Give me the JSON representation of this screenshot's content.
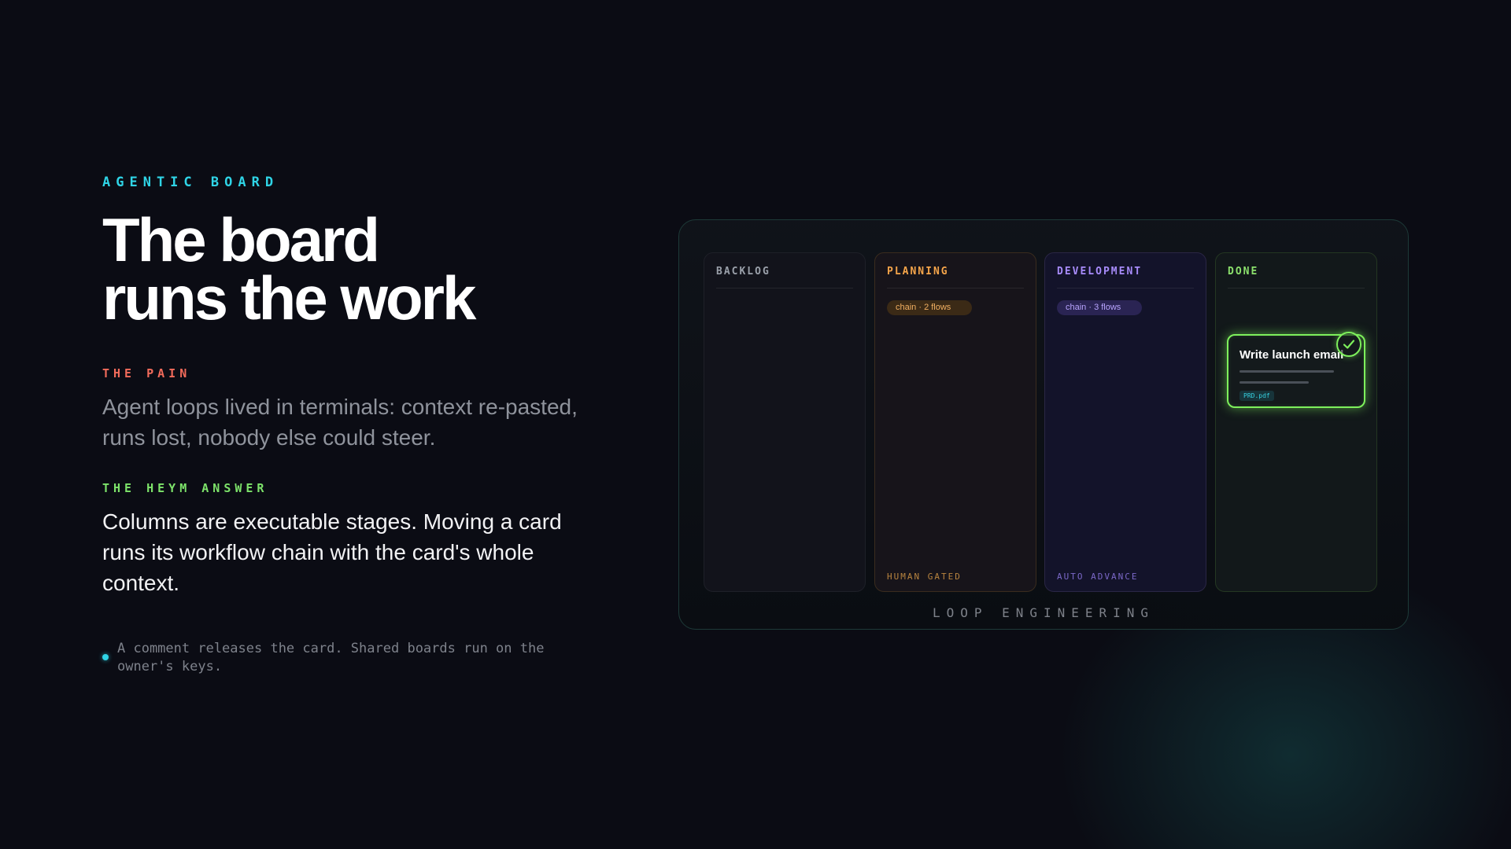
{
  "hero": {
    "eyebrow": "AGENTIC BOARD",
    "headline_line1": "The board",
    "headline_line2": "runs the work"
  },
  "pain": {
    "label": "THE PAIN",
    "text": "Agent loops lived in terminals: context re-pasted, runs lost, nobody else could steer."
  },
  "answer": {
    "label": "THE HEYM ANSWER",
    "text": "Columns are executable stages. Moving a card runs its workflow chain with the card's whole context."
  },
  "note": {
    "text": "A comment releases the card. Shared boards run on the owner's keys."
  },
  "board": {
    "caption": "LOOP ENGINEERING",
    "columns": [
      {
        "title": "BACKLOG",
        "chip": "",
        "footer": ""
      },
      {
        "title": "PLANNING",
        "chip": "chain · 2 flows",
        "footer": "HUMAN GATED"
      },
      {
        "title": "DEVELOPMENT",
        "chip": "chain · 3 flows",
        "footer": "AUTO ADVANCE"
      },
      {
        "title": "DONE",
        "chip": "",
        "footer": ""
      }
    ],
    "done_card": {
      "title": "Write launch email",
      "attachment": "PRD.pdf",
      "status_icon": "check-circle-icon"
    }
  },
  "colors": {
    "background": "#0b0c14",
    "accent_cyan": "#2fd4e6",
    "pain_red": "#f26b5b",
    "answer_green": "#7de36a",
    "planning_orange": "#f6a54a",
    "development_purple": "#a78bfa",
    "done_green": "#8be06c"
  }
}
